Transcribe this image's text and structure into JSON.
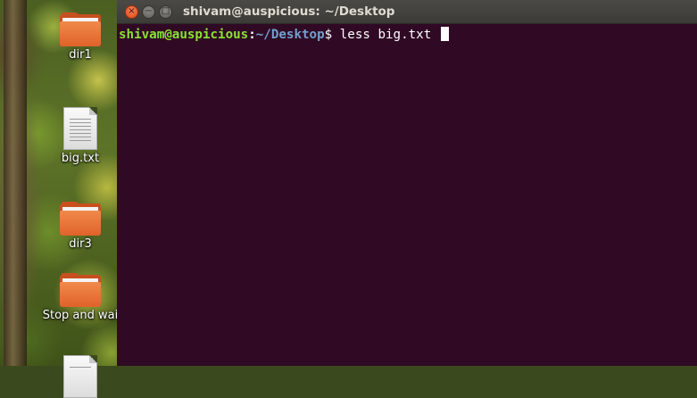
{
  "desktop": {
    "icons": [
      {
        "label": "dir1",
        "kind": "folder-icon"
      },
      {
        "label": "big.txt",
        "kind": "text-file-icon"
      },
      {
        "label": "dir3",
        "kind": "folder-icon"
      },
      {
        "label": "Stop and wai",
        "kind": "folder-icon"
      },
      {
        "label": "",
        "kind": "text-file-icon"
      }
    ]
  },
  "terminal": {
    "title": "shivam@auspicious: ~/Desktop",
    "buttons": {
      "close": "×",
      "minimize": "−",
      "maximize": "□"
    },
    "prompt": {
      "user_host": "shivam@auspicious",
      "colon": ":",
      "path": "~/Desktop",
      "dollar": "$ ",
      "command": "less big.txt "
    },
    "colors": {
      "background": "#300a24",
      "user_host": "#8ae234",
      "path": "#729fcf"
    }
  }
}
